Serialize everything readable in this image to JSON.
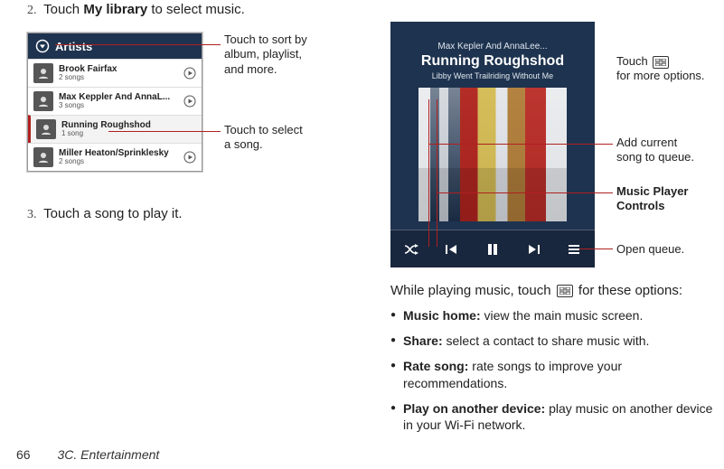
{
  "steps": {
    "s2_num": "2.",
    "s2_a": "Touch ",
    "s2_bold": "My library",
    "s2_b": " to select music.",
    "s3_num": "3.",
    "s3": "Touch a song to play it."
  },
  "artists": {
    "header": "Artists",
    "items": [
      {
        "name": "Brook Fairfax",
        "sub": "2 songs",
        "play": true,
        "selected": false
      },
      {
        "name": "Max Keppler And AnnaL...",
        "sub": "3 songs",
        "play": true,
        "selected": false
      },
      {
        "name": "Running Roughshod",
        "sub": "1 song",
        "play": false,
        "selected": true
      },
      {
        "name": "Miller Heaton/Sprinklesky",
        "sub": "2 songs",
        "play": true,
        "selected": false
      }
    ]
  },
  "callouts_left": {
    "c1": "Touch  to sort by\nalbum, playlist,\nand more.",
    "c2": "Touch to select\na song."
  },
  "player": {
    "artist": "Max Kepler And AnnaLee...",
    "title": "Running Roughshod",
    "album": "Libby Went Trailriding Without  Me"
  },
  "callouts_right": {
    "c1a": "Touch ",
    "c1b": "\nfor more options.",
    "c2": "Add current\nsong to queue.",
    "c3": "Music Player\nControls",
    "c4": "Open queue."
  },
  "while": {
    "a": "While playing music, touch ",
    "b": " for these options:"
  },
  "options": {
    "o1_b": "Music home:",
    "o1_t": " view the main music screen.",
    "o2_b": "Share:",
    "o2_t": " select a contact to share music with.",
    "o3_b": "Rate song:",
    "o3_t": " rate songs to improve your recommendations.",
    "o4_b": "Play on another device:",
    "o4_t": " play music on another device in your Wi-Fi network."
  },
  "footer": {
    "page": "66",
    "section": "3C. Entertainment"
  }
}
